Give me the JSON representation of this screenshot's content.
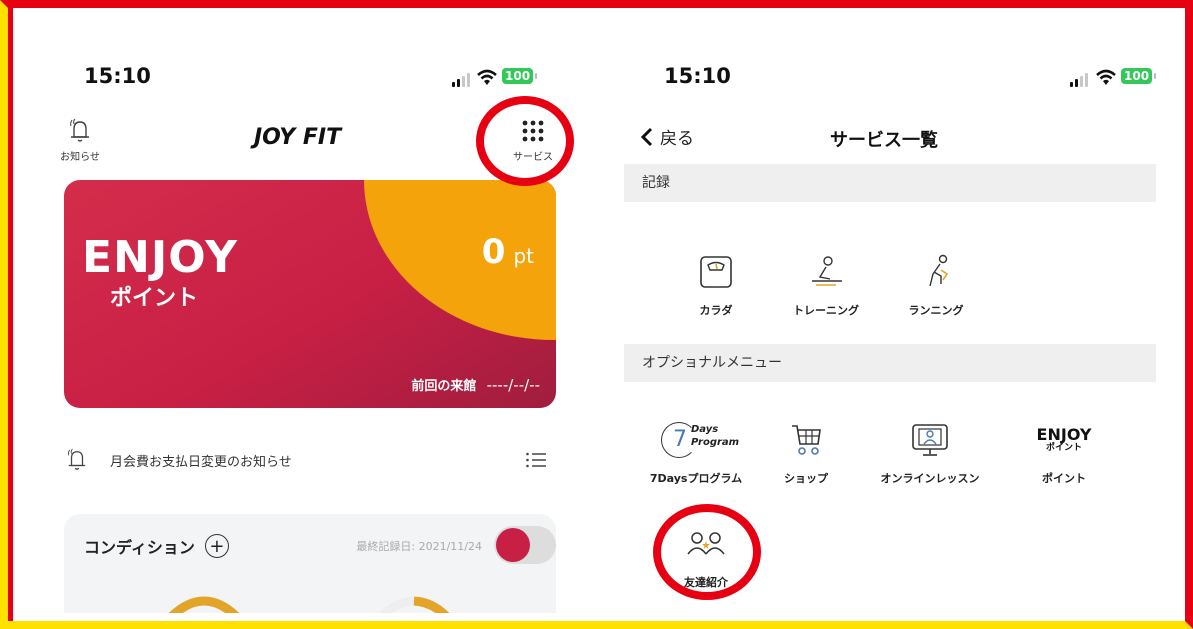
{
  "left_screen": {
    "status": {
      "time": "15:10",
      "battery": "100"
    },
    "header": {
      "notifications_label": "お知らせ",
      "logo": "JOY FIT",
      "services_label": "サービス"
    },
    "points_card": {
      "brand": "ENJOY",
      "subtitle": "ポイント",
      "points_value": "0",
      "points_unit": "pt",
      "last_visit_label": "前回の来館",
      "last_visit_value": "----/--/--"
    },
    "notice": {
      "text": "月会費お支払日変更のお知らせ"
    },
    "condition": {
      "title": "コンディション",
      "last_record_label": "最終記録日: 2021/11/24"
    }
  },
  "right_screen": {
    "status": {
      "time": "15:10",
      "battery": "100"
    },
    "nav": {
      "back_label": "戻る",
      "title": "サービス一覧"
    },
    "sections": [
      {
        "title": "記録",
        "items": [
          {
            "label": "カラダ",
            "icon": "scale-icon"
          },
          {
            "label": "トレーニング",
            "icon": "training-icon"
          },
          {
            "label": "ランニング",
            "icon": "running-icon"
          }
        ]
      },
      {
        "title": "オプショナルメニュー",
        "items": [
          {
            "label": "7Daysプログラム",
            "icon": "7days-program-icon",
            "icon_text_1": "7",
            "icon_text_2": "Days",
            "icon_text_3": "Program"
          },
          {
            "label": "ショップ",
            "icon": "cart-icon"
          },
          {
            "label": "オンラインレッスン",
            "icon": "monitor-icon"
          },
          {
            "label": "ポイント",
            "icon": "enjoy-logo-icon",
            "icon_text_1": "ENJOY",
            "icon_text_2": "ポイント"
          },
          {
            "label": "友達紹介",
            "icon": "friends-icon"
          }
        ]
      }
    ]
  },
  "colors": {
    "highlight_ring": "#e60012",
    "card_red": "#c81f45",
    "card_orange": "#f5a30b",
    "accent_gold": "#e2a52a"
  }
}
